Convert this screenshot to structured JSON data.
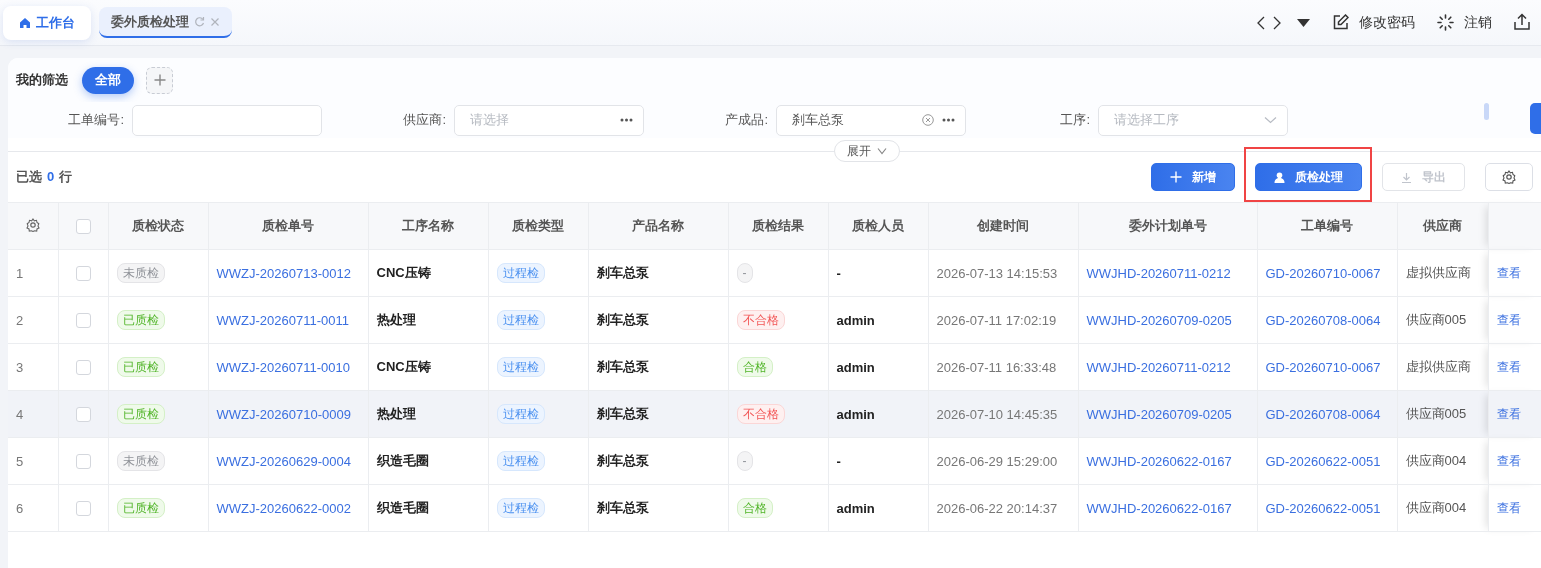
{
  "top_tabs": [
    {
      "kind": "home",
      "label": "工作台",
      "selected": false
    },
    {
      "kind": "page",
      "label": "委外质检处理",
      "selected": true
    }
  ],
  "header_links": [
    {
      "kind": "edit",
      "label": "修改密码"
    },
    {
      "kind": "logout",
      "label": "注销"
    }
  ],
  "filter": {
    "title": "我的筛选",
    "chips": [
      {
        "label": "全部",
        "selected": true
      }
    ],
    "fields": [
      {
        "kind": "input",
        "label": "工单编号:"
      },
      {
        "kind": "picker",
        "label": "供应商:",
        "placeholder": "请选择"
      },
      {
        "kind": "picker",
        "label": "产成品:",
        "value": "刹车总泵",
        "clearable": true
      },
      {
        "kind": "select",
        "label": "工序:",
        "placeholder": "请选择工序"
      }
    ],
    "expand_label": "展开"
  },
  "selection": {
    "prefix": "已选",
    "count": "0",
    "suffix": "行"
  },
  "toolbar_buttons": [
    {
      "kind": "add",
      "label": "新增",
      "disabled": false,
      "highlighted": false
    },
    {
      "kind": "process",
      "label": "质检处理",
      "disabled": false,
      "highlighted": true
    },
    {
      "kind": "export",
      "label": "导出",
      "disabled": true,
      "highlighted": false
    },
    {
      "kind": "settings",
      "disabled": false,
      "highlighted": false
    }
  ],
  "table": {
    "header_checked": false,
    "columns": [
      "质检状态",
      "质检单号",
      "工序名称",
      "质检类型",
      "产品名称",
      "质检结果",
      "质检人员",
      "创建时间",
      "委外计划单号",
      "工单编号",
      "供应商"
    ],
    "rows": [
      {
        "index": "1",
        "checked": false,
        "highlighted": false,
        "status": {
          "label": "未质检",
          "kind": "pending"
        },
        "inspection_no": "WWZJ-20260713-0012",
        "process": "CNC压铸",
        "type": "过程检",
        "product": "刹车总泵",
        "result": {
          "label": "-",
          "kind": "none"
        },
        "inspector": "-",
        "created": "2026-07-13 14:15:53",
        "plan_no": "WWJHD-20260711-0212",
        "work_order": "GD-20260710-0067",
        "supplier": "虚拟供应商",
        "action": "查看"
      },
      {
        "index": "2",
        "checked": false,
        "highlighted": false,
        "status": {
          "label": "已质检",
          "kind": "done"
        },
        "inspection_no": "WWZJ-20260711-0011",
        "process": "热处理",
        "type": "过程检",
        "product": "刹车总泵",
        "result": {
          "label": "不合格",
          "kind": "fail"
        },
        "inspector": "admin",
        "created": "2026-07-11 17:02:19",
        "plan_no": "WWJHD-20260709-0205",
        "work_order": "GD-20260708-0064",
        "supplier": "供应商005",
        "action": "查看"
      },
      {
        "index": "3",
        "checked": false,
        "highlighted": false,
        "status": {
          "label": "已质检",
          "kind": "done"
        },
        "inspection_no": "WWZJ-20260711-0010",
        "process": "CNC压铸",
        "type": "过程检",
        "product": "刹车总泵",
        "result": {
          "label": "合格",
          "kind": "pass"
        },
        "inspector": "admin",
        "created": "2026-07-11 16:33:48",
        "plan_no": "WWJHD-20260711-0212",
        "work_order": "GD-20260710-0067",
        "supplier": "虚拟供应商",
        "action": "查看"
      },
      {
        "index": "4",
        "checked": false,
        "highlighted": true,
        "status": {
          "label": "已质检",
          "kind": "done"
        },
        "inspection_no": "WWZJ-20260710-0009",
        "process": "热处理",
        "type": "过程检",
        "product": "刹车总泵",
        "result": {
          "label": "不合格",
          "kind": "fail"
        },
        "inspector": "admin",
        "created": "2026-07-10 14:45:35",
        "plan_no": "WWJHD-20260709-0205",
        "work_order": "GD-20260708-0064",
        "supplier": "供应商005",
        "action": "查看"
      },
      {
        "index": "5",
        "checked": false,
        "highlighted": false,
        "status": {
          "label": "未质检",
          "kind": "pending"
        },
        "inspection_no": "WWZJ-20260629-0004",
        "process": "织造毛圈",
        "type": "过程检",
        "product": "刹车总泵",
        "result": {
          "label": "-",
          "kind": "none"
        },
        "inspector": "-",
        "created": "2026-06-29 15:29:00",
        "plan_no": "WWJHD-20260622-0167",
        "work_order": "GD-20260622-0051",
        "supplier": "供应商004",
        "action": "查看"
      },
      {
        "index": "6",
        "checked": false,
        "highlighted": false,
        "status": {
          "label": "已质检",
          "kind": "done"
        },
        "inspection_no": "WWZJ-20260622-0002",
        "process": "织造毛圈",
        "type": "过程检",
        "product": "刹车总泵",
        "result": {
          "label": "合格",
          "kind": "pass"
        },
        "inspector": "admin",
        "created": "2026-06-22 20:14:37",
        "plan_no": "WWJHD-20260622-0167",
        "work_order": "GD-20260622-0051",
        "supplier": "供应商004",
        "action": "查看"
      }
    ]
  }
}
